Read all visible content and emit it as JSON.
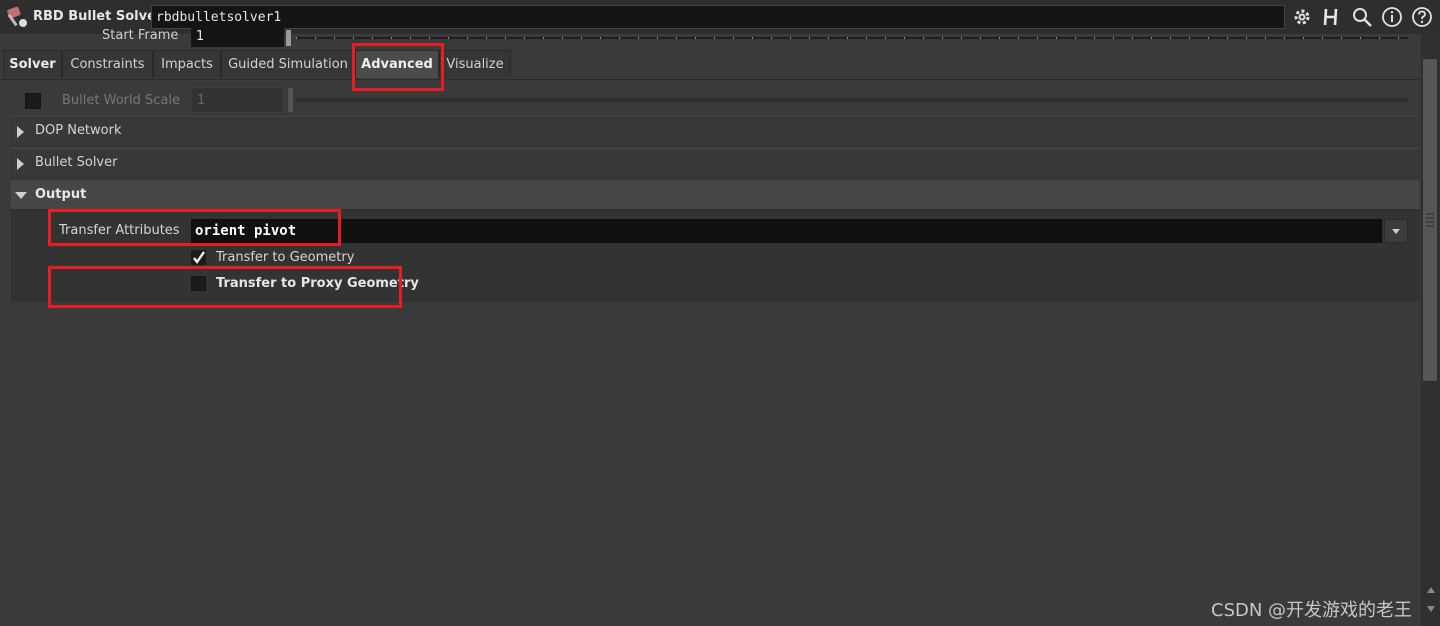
{
  "header": {
    "node_type": "RBD Bullet Solver",
    "node_name": "rbdbulletsolver1",
    "icons": [
      "node-icon",
      "gear-icon",
      "houdini-h-icon",
      "search-icon",
      "info-icon",
      "help-icon"
    ]
  },
  "start_frame": {
    "label": "Start Frame",
    "value": "1"
  },
  "tabs": [
    {
      "label": "Solver"
    },
    {
      "label": "Constraints"
    },
    {
      "label": "Impacts"
    },
    {
      "label": "Guided Simulation"
    },
    {
      "label": "Advanced",
      "active": true
    },
    {
      "label": "Visualize"
    }
  ],
  "bullet_world_scale": {
    "label": "Bullet World Scale",
    "value": "1",
    "enabled": false
  },
  "folders": {
    "dop_network": "DOP Network",
    "bullet_solver": "Bullet Solver",
    "output": "Output"
  },
  "output": {
    "transfer_attributes_label": "Transfer Attributes",
    "transfer_attributes_value": "orient pivot",
    "transfer_to_geometry_label": "Transfer to Geometry",
    "transfer_to_geometry_checked": true,
    "transfer_to_proxy_label": "Transfer to Proxy Geometry",
    "transfer_to_proxy_checked": false
  },
  "watermark": "CSDN @开发游戏的老王",
  "colors": {
    "highlight": "#e81c23",
    "background": "#3a3a3a",
    "field": "#101010"
  }
}
